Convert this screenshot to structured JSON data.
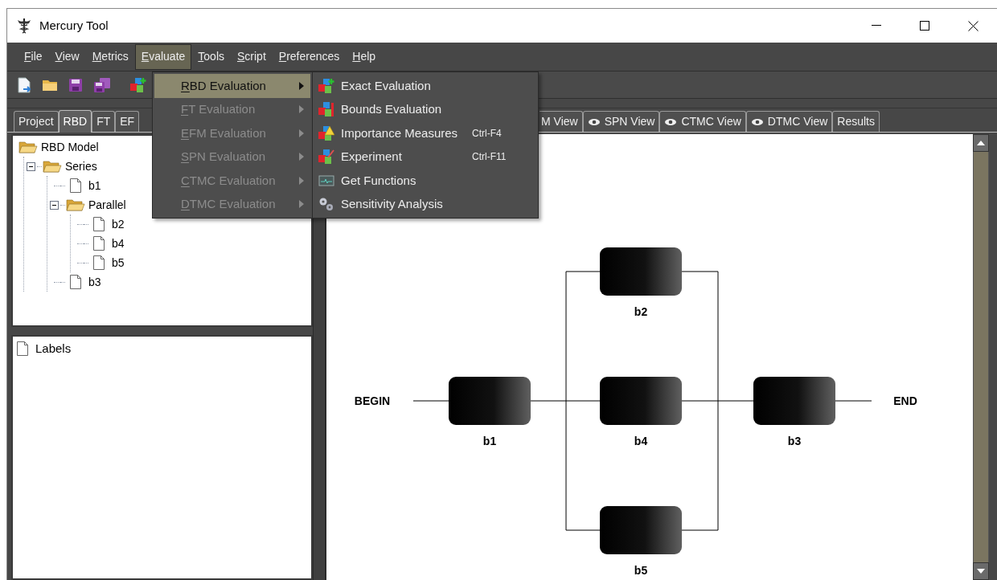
{
  "window": {
    "title": "Mercury Tool"
  },
  "menu_bar": [
    {
      "label": "File",
      "mnemonic": true,
      "selected": false
    },
    {
      "label": "View",
      "mnemonic": true,
      "selected": false
    },
    {
      "label": "Metrics",
      "mnemonic": true,
      "selected": false
    },
    {
      "label": "Evaluate",
      "mnemonic": true,
      "selected": true
    },
    {
      "label": "Tools",
      "mnemonic": true,
      "selected": false
    },
    {
      "label": "Script",
      "mnemonic": true,
      "selected": false
    },
    {
      "label": "Preferences",
      "mnemonic": true,
      "selected": false
    },
    {
      "label": "Help",
      "mnemonic": true,
      "selected": false
    }
  ],
  "toolbar": [
    {
      "kind": "new"
    },
    {
      "kind": "open"
    },
    {
      "kind": "save"
    },
    {
      "kind": "save_all"
    },
    {
      "kind": "blocks"
    }
  ],
  "evaluate_menu": [
    {
      "label": "RBD Evaluation",
      "disabled": false,
      "selected": true
    },
    {
      "label": "FT Evaluation",
      "disabled": true,
      "selected": false
    },
    {
      "label": "EFM Evaluation",
      "disabled": true,
      "selected": false
    },
    {
      "label": "SPN Evaluation",
      "disabled": true,
      "selected": false
    },
    {
      "label": "CTMC Evaluation",
      "disabled": true,
      "selected": false
    },
    {
      "label": "DTMC Evaluation",
      "disabled": true,
      "selected": false
    }
  ],
  "rbd_submenu": [
    {
      "label": "Exact Evaluation",
      "kind": "exact"
    },
    {
      "label": "Bounds Evaluation",
      "kind": "bounds"
    },
    {
      "label": "Importance Measures",
      "kind": "importance",
      "shortcut": "Ctrl-F4"
    },
    {
      "label": "Experiment",
      "kind": "experiment",
      "shortcut": "Ctrl-F11"
    },
    {
      "label": "Get Functions",
      "kind": "functions"
    },
    {
      "label": "Sensitivity Analysis",
      "kind": "sensitivity"
    }
  ],
  "tabs_left": [
    {
      "label": "Project",
      "selected": false
    },
    {
      "label": "RBD",
      "selected": true
    },
    {
      "label": "FT",
      "selected": false
    },
    {
      "label": "EF",
      "selected": false
    }
  ],
  "tabs_right": [
    {
      "label": "M View",
      "eye": false,
      "selected": false
    },
    {
      "label": "SPN View",
      "eye": true,
      "selected": false
    },
    {
      "label": "CTMC View",
      "eye": true,
      "selected": false
    },
    {
      "label": "DTMC View",
      "eye": true,
      "selected": false
    },
    {
      "label": "Results",
      "eye": false,
      "selected": false
    }
  ],
  "tree": [
    {
      "label": "RBD Model",
      "kind": "folder",
      "children": [
        {
          "label": "Series",
          "kind": "folder",
          "expanded": true,
          "children": [
            {
              "label": "b1",
              "kind": "file"
            },
            {
              "label": "Parallel",
              "kind": "folder",
              "expanded": true,
              "children": [
                {
                  "label": "b2",
                  "kind": "file"
                },
                {
                  "label": "b4",
                  "kind": "file"
                },
                {
                  "label": "b5",
                  "kind": "file"
                }
              ]
            },
            {
              "label": "b3",
              "kind": "file"
            }
          ]
        }
      ]
    }
  ],
  "labels_panel": [
    {
      "label": "Labels"
    }
  ],
  "diagram": {
    "begin": "BEGIN",
    "end": "END",
    "series": [
      {
        "kind": "block",
        "label": "b1"
      },
      {
        "kind": "parallel",
        "blocks": [
          {
            "label": "b2"
          },
          {
            "label": "b4"
          },
          {
            "label": "b5"
          }
        ]
      },
      {
        "kind": "block",
        "label": "b3"
      }
    ]
  }
}
